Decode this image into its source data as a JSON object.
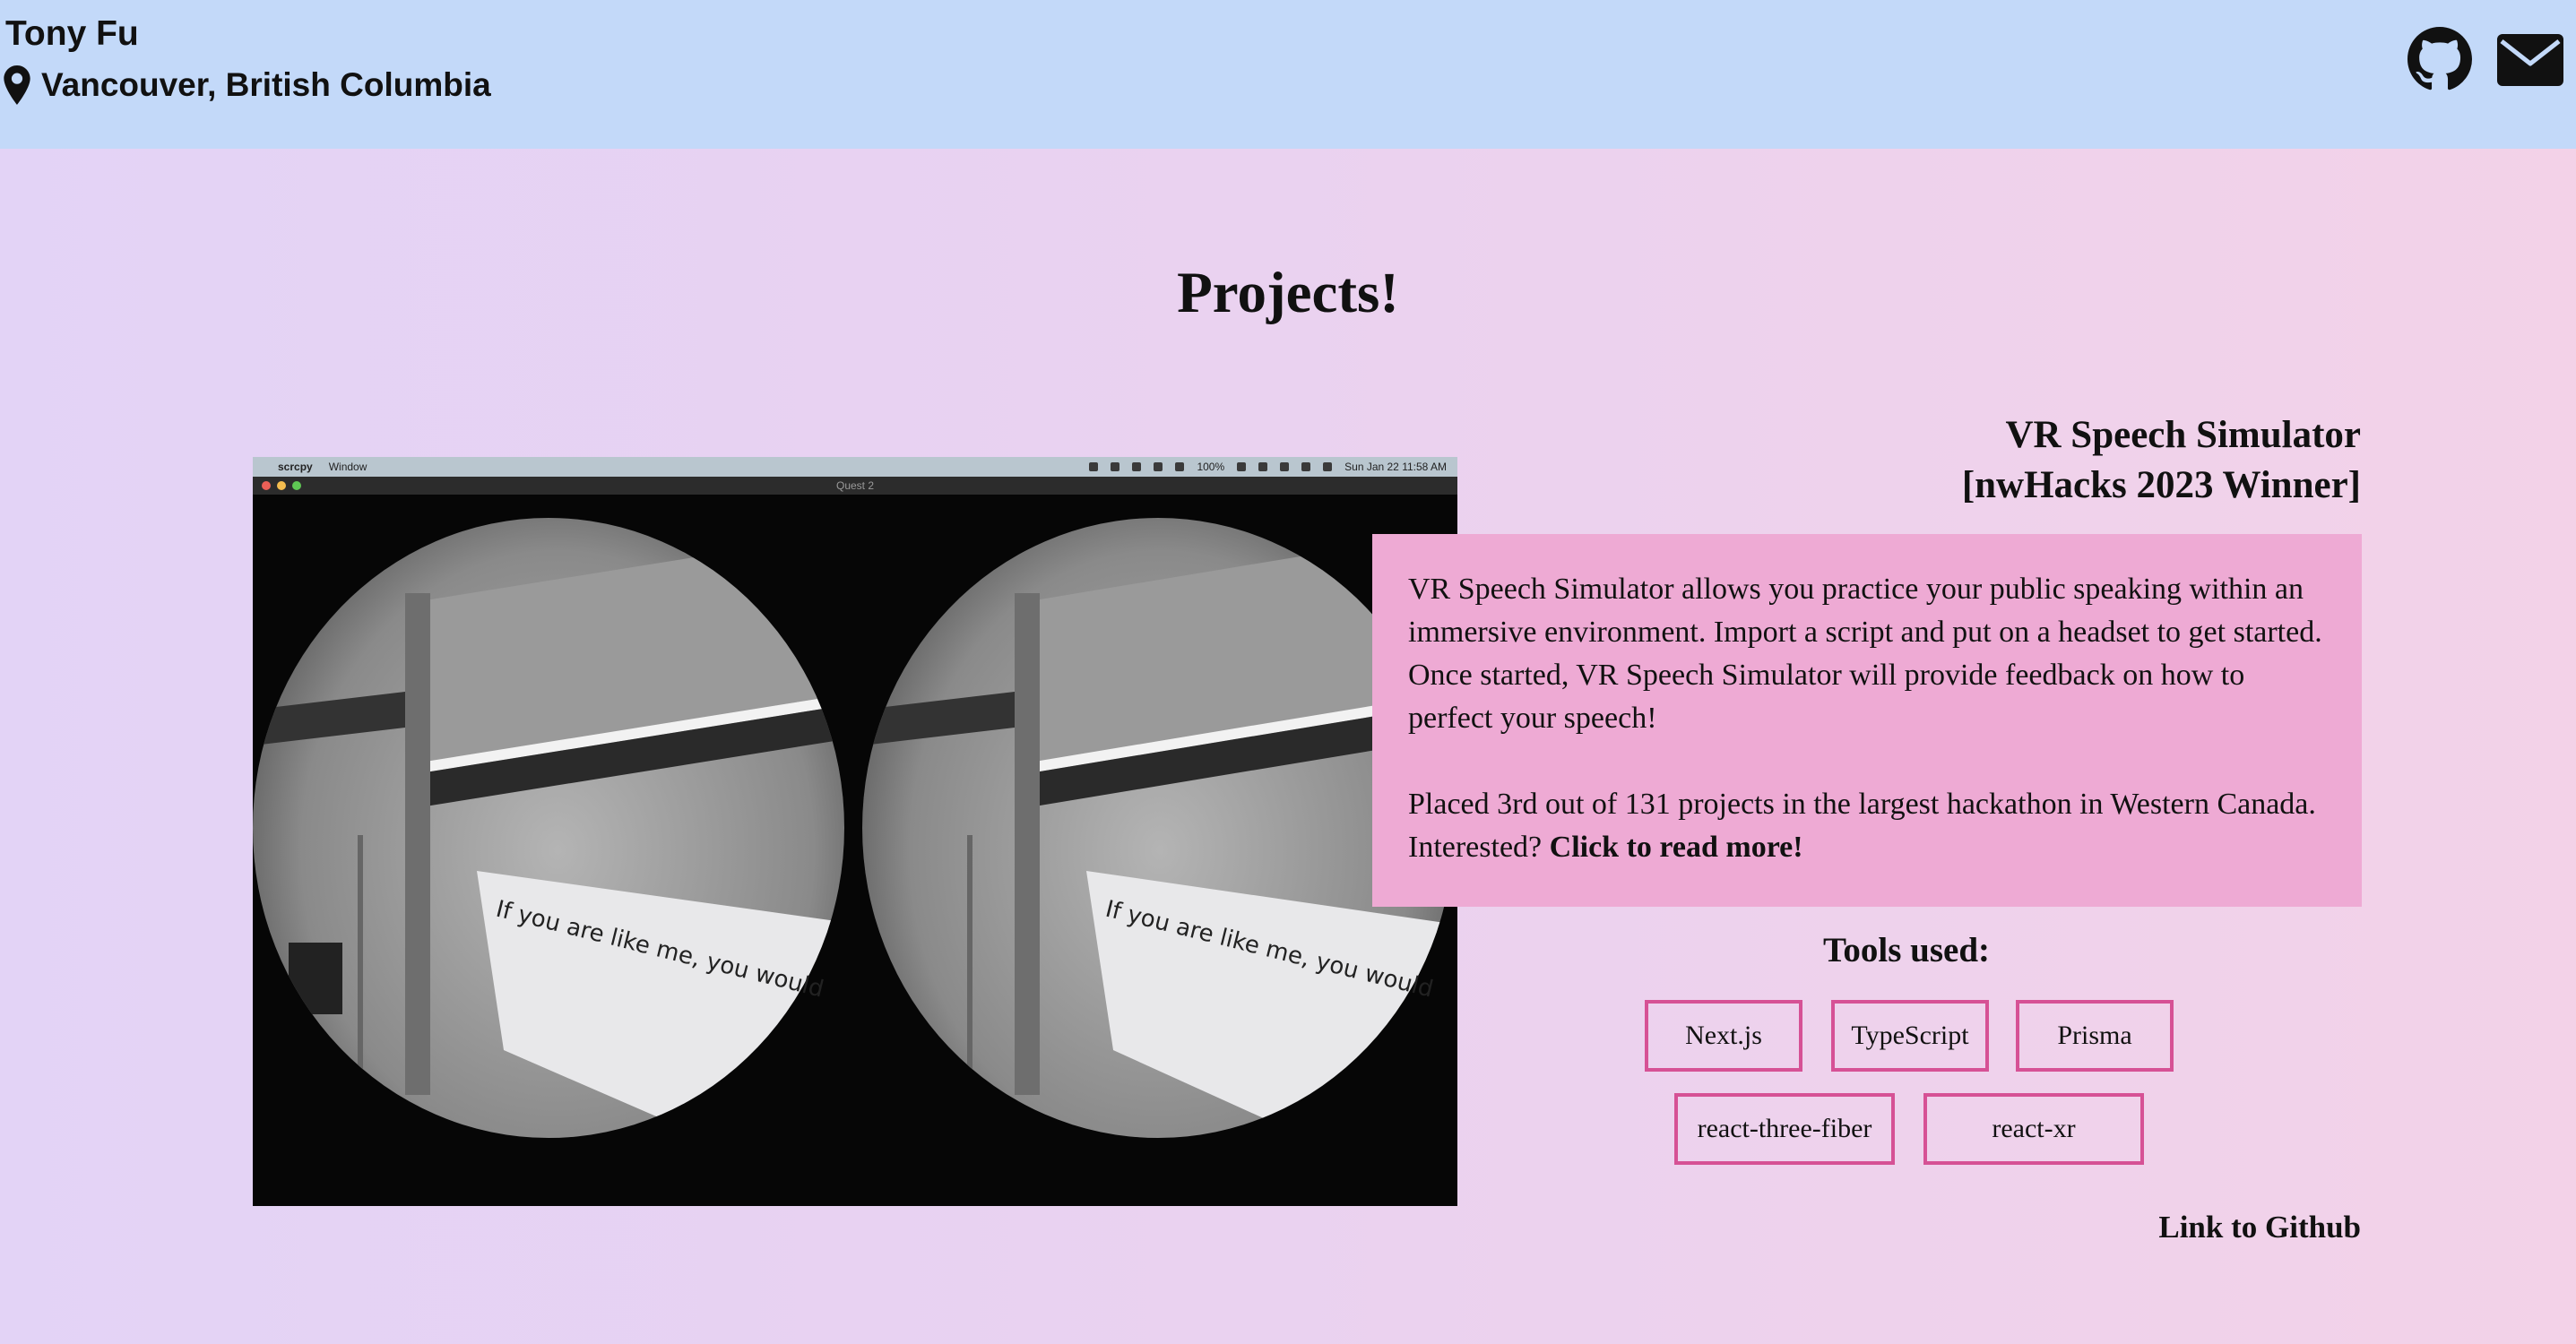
{
  "header": {
    "name": "Tony Fu",
    "location": "Vancouver, British Columbia",
    "icons": {
      "location": "map-pin-icon",
      "github": "github-icon",
      "mail": "mail-icon"
    }
  },
  "page": {
    "title": "Projects!"
  },
  "project": {
    "title_line1": "VR Speech Simulator",
    "title_line2": "[nwHacks 2023 Winner]",
    "description": "VR Speech Simulator allows you practice your public speaking within an immersive environment. Import a script and put on a headset to get started. Once started, VR Speech Simulator will provide feedback on how to perfect your speech!",
    "placement": "Placed 3rd out of 131 projects in the largest hackathon in Western Canada. Interested?",
    "read_more": "Click to read more!",
    "tools_heading": "Tools used:",
    "tools": [
      "Next.js",
      "TypeScript",
      "Prisma",
      "react-three-fiber",
      "react-xr"
    ],
    "github_link": "Link to Github",
    "accent_color": "#d65195",
    "box_color": "#eeaad4"
  },
  "screenshot": {
    "menubar": {
      "app": "scrcpy",
      "menu": "Window",
      "battery": "100%",
      "datetime": "Sun Jan 22  11:58 AM"
    },
    "window_title": "Quest 2",
    "slide_text": "If you are like me, you would agree that you have a fear of speaking. Throughout my entire life, I have struggled with speaking in front of a crowd and speaking to them, similar to what I'm doing right now. To better prepare myself, I would practise for ages"
  }
}
